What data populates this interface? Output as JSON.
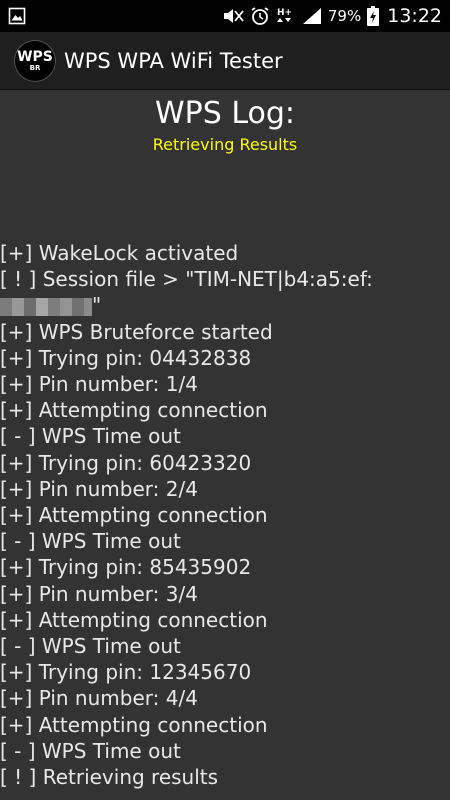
{
  "status_bar": {
    "battery_percent": "79%",
    "time": "13:22",
    "icons": [
      "image-icon",
      "mute-icon",
      "alarm-icon",
      "hplus-data-icon",
      "signal-icon",
      "battery-charging-icon"
    ]
  },
  "action_bar": {
    "logo_top": "WPS",
    "logo_bottom": "BR",
    "title": "WPS WPA WiFi Tester"
  },
  "log": {
    "title": "WPS Log:",
    "status": "Retrieving Results",
    "status_color": "#ffff00",
    "lines": [
      "[+] WakeLock activated",
      "[ ! ] Session file > \"TIM-NET|b4:a5:ef:",
      "\"",
      "[+] WPS Bruteforce started",
      "[+] Trying pin: 04432838",
      "[+] Pin number: 1/4",
      "[+] Attempting connection",
      "[ - ] WPS Time out",
      "[+] Trying pin: 60423320",
      "[+] Pin number: 2/4",
      "[+] Attempting connection",
      "[ - ] WPS Time out",
      "[+] Trying pin: 85435902",
      "[+] Pin number: 3/4",
      "[+] Attempting connection",
      "[ - ] WPS Time out",
      "[+] Trying pin: 12345670",
      "[+] Pin number: 4/4",
      "[+] Attempting connection",
      "[ - ] WPS Time out",
      "[ ! ] Retrieving results"
    ]
  }
}
